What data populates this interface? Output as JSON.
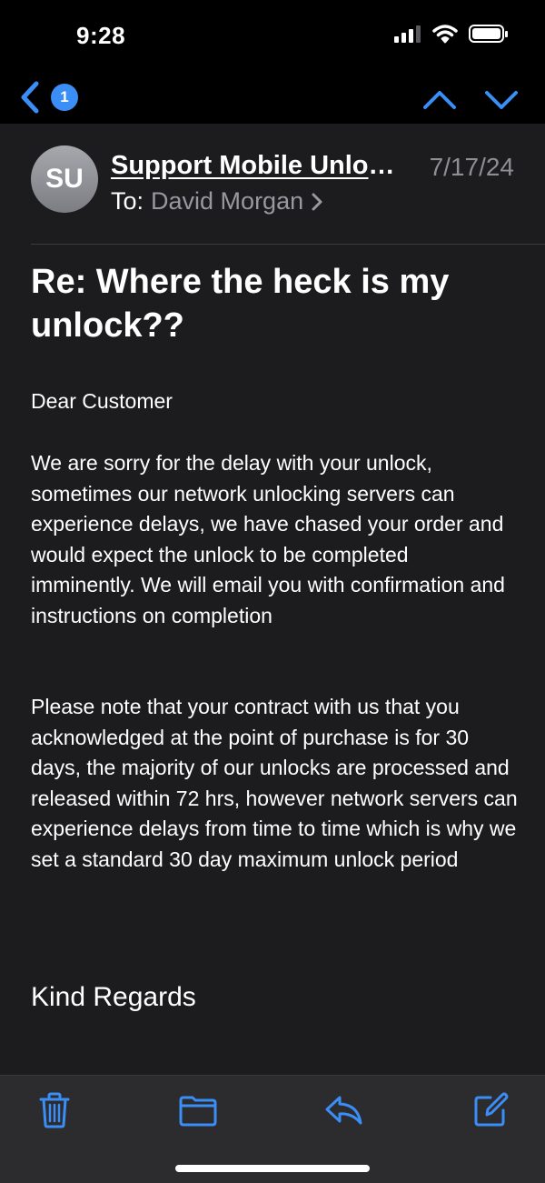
{
  "status_bar": {
    "time": "9:28",
    "icons": [
      "signal-icon",
      "wifi-icon",
      "battery-icon"
    ]
  },
  "nav": {
    "unread_count": "1",
    "icons": [
      "back-chevron-icon",
      "up-arrow-icon",
      "down-arrow-icon"
    ]
  },
  "email": {
    "avatar_initials": "SU",
    "sender": "Support Mobile Unlocks",
    "date": "7/17/24",
    "to_label": "To:",
    "recipient": "David Morgan",
    "subject": "Re: Where the heck is my unlock??",
    "greeting": "Dear Customer",
    "paragraph1": "We are sorry for the delay with your unlock, sometimes our network unlocking servers can experience delays, we have chased your order and would expect the unlock to be completed imminently. We will email you with confirmation and instructions on completion",
    "paragraph2": "Please note that your contract with us that you acknowledged at the point of purchase is for 30 days, the majority of our unlocks are processed and released within 72 hrs, however network servers can experience delays from time to time which is why we set a standard 30 day maximum unlock period",
    "signoff": "Kind Regards"
  },
  "toolbar": {
    "icons": [
      "trash-icon",
      "folder-icon",
      "reply-icon",
      "compose-icon"
    ]
  },
  "colors": {
    "accent": "#3a8ef6",
    "background": "#1c1c1e",
    "secondary_text": "#8e8e93"
  }
}
